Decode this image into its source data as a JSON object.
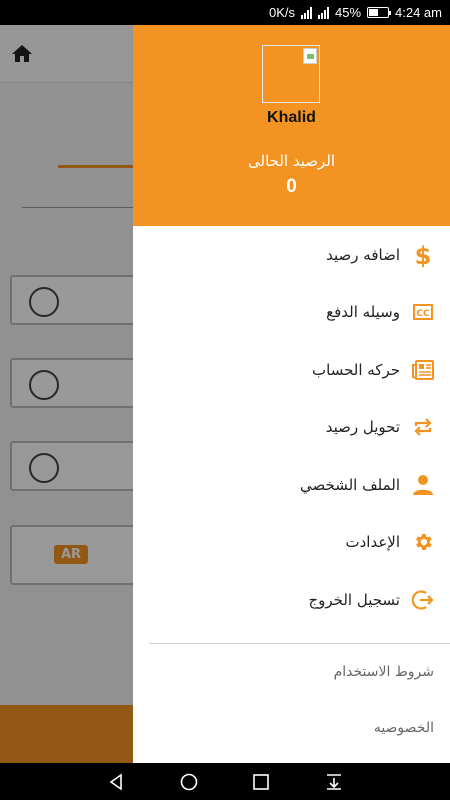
{
  "status_bar": {
    "net_speed": "0K/s",
    "battery": "45%",
    "time": "4:24 am"
  },
  "background_app": {
    "language_badge": "AR"
  },
  "drawer": {
    "user_name": "Khalid",
    "balance_label": "الرصيد الحالى",
    "balance_value": "0",
    "menu": [
      {
        "label": "اضافه رصيد",
        "icon": "dollar-icon"
      },
      {
        "label": "وسيله الدفع",
        "icon": "credit-card-icon"
      },
      {
        "label": "حركه الحساب",
        "icon": "newspaper-icon"
      },
      {
        "label": "تحويل رصيد",
        "icon": "transfer-icon"
      },
      {
        "label": "الملف الشخصي",
        "icon": "person-icon"
      },
      {
        "label": "الإعدادت",
        "icon": "gear-icon"
      },
      {
        "label": "تسجيل الخروج",
        "icon": "logout-icon"
      }
    ],
    "footer": [
      {
        "label": "شروط الاستخدام"
      },
      {
        "label": "الخصوصيه"
      }
    ]
  },
  "colors": {
    "accent": "#f39322",
    "scrim": "#000000"
  }
}
